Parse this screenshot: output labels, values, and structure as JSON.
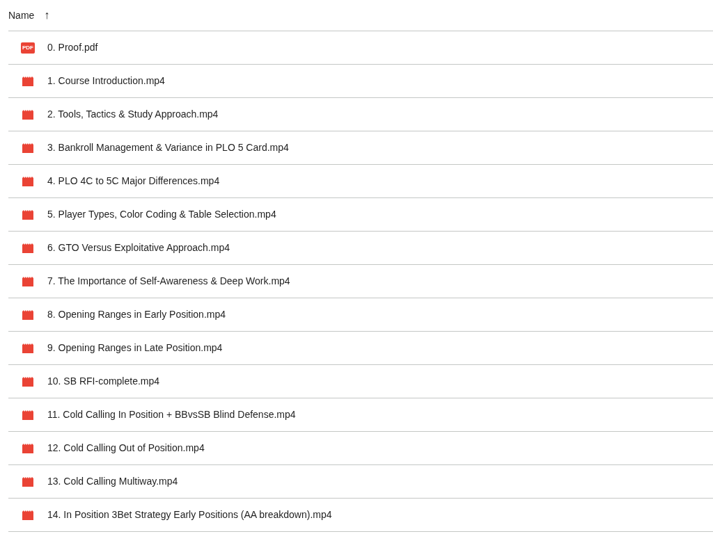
{
  "header": {
    "column": "Name",
    "sort_icon": "↑"
  },
  "files": [
    {
      "kind": "pdf",
      "icon_label": "PDF",
      "name": "0. Proof.pdf"
    },
    {
      "kind": "video",
      "name": "1. Course Introduction.mp4"
    },
    {
      "kind": "video",
      "name": "2. Tools, Tactics & Study Approach.mp4"
    },
    {
      "kind": "video",
      "name": "3. Bankroll Management & Variance in PLO 5 Card.mp4"
    },
    {
      "kind": "video",
      "name": "4. PLO 4C to 5C Major Differences.mp4"
    },
    {
      "kind": "video",
      "name": "5. Player Types, Color Coding & Table Selection.mp4"
    },
    {
      "kind": "video",
      "name": "6. GTO Versus Exploitative Approach.mp4"
    },
    {
      "kind": "video",
      "name": "7. The Importance of Self-Awareness & Deep Work.mp4"
    },
    {
      "kind": "video",
      "name": "8. Opening Ranges in Early Position.mp4"
    },
    {
      "kind": "video",
      "name": "9. Opening Ranges in Late Position.mp4"
    },
    {
      "kind": "video",
      "name": "10. SB RFI-complete.mp4"
    },
    {
      "kind": "video",
      "name": "11. Cold Calling In Position + BBvsSB Blind Defense.mp4"
    },
    {
      "kind": "video",
      "name": "12. Cold Calling Out of Position.mp4"
    },
    {
      "kind": "video",
      "name": "13. Cold Calling Multiway.mp4"
    },
    {
      "kind": "video",
      "name": "14. In Position 3Bet Strategy Early Positions (AA breakdown).mp4"
    }
  ]
}
